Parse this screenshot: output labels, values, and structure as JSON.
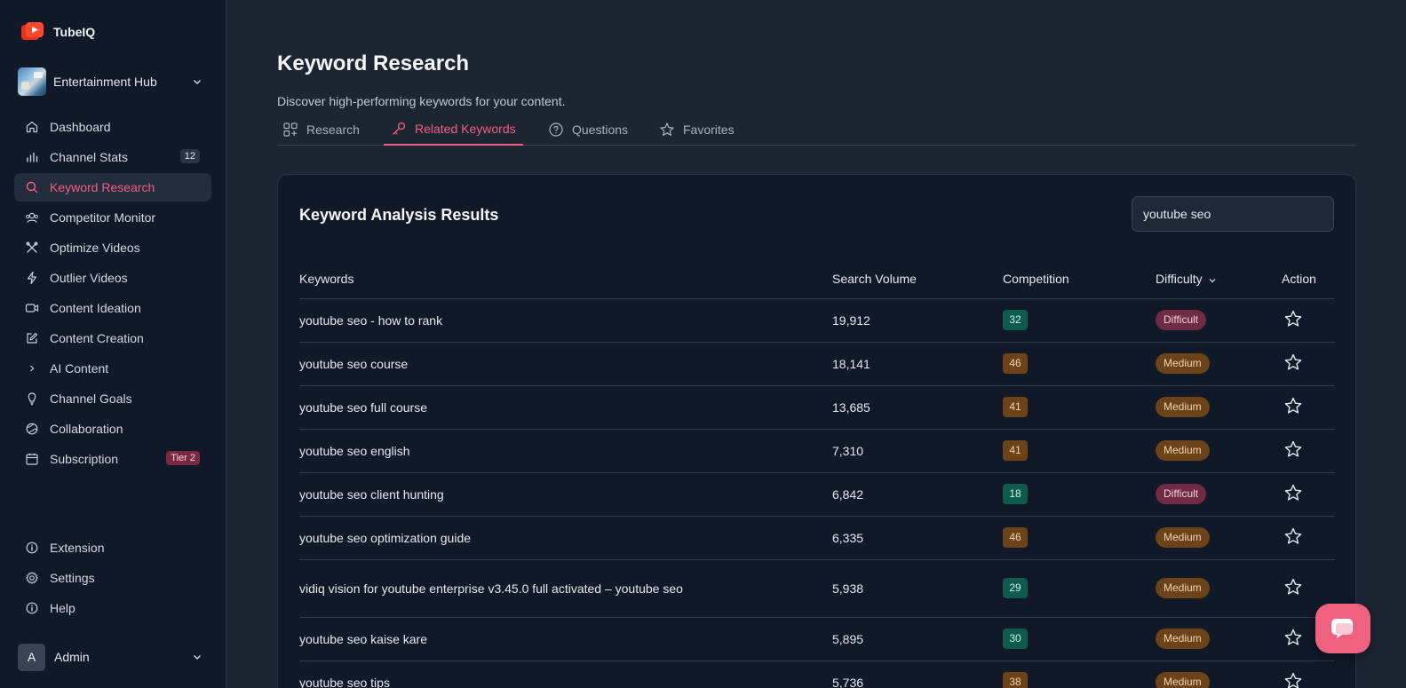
{
  "brand": {
    "name": "TubeIQ"
  },
  "channel": {
    "name": "Entertainment Hub"
  },
  "sidebar": {
    "items": [
      {
        "label": "Dashboard",
        "icon": "home-icon"
      },
      {
        "label": "Channel Stats",
        "icon": "bar-chart-icon",
        "badge": "12"
      },
      {
        "label": "Keyword Research",
        "icon": "search-icon",
        "active": true
      },
      {
        "label": "Competitor Monitor",
        "icon": "users-icon"
      },
      {
        "label": "Optimize Videos",
        "icon": "tools-icon"
      },
      {
        "label": "Outlier Videos",
        "icon": "bolt-icon"
      },
      {
        "label": "Content Ideation",
        "icon": "video-icon"
      },
      {
        "label": "Content Creation",
        "icon": "edit-icon"
      },
      {
        "label": "AI Content",
        "icon": "chevron-right-icon"
      },
      {
        "label": "Channel Goals",
        "icon": "lightbulb-icon"
      },
      {
        "label": "Collaboration",
        "icon": "globe-icon"
      },
      {
        "label": "Subscription",
        "icon": "calendar-icon",
        "badge": "Tier 2"
      }
    ],
    "bottom": [
      {
        "label": "Extension",
        "icon": "info-icon"
      },
      {
        "label": "Settings",
        "icon": "gear-icon"
      },
      {
        "label": "Help",
        "icon": "info-icon"
      }
    ]
  },
  "user": {
    "initial": "A",
    "name": "Admin"
  },
  "page": {
    "title": "Keyword Research",
    "subtitle": "Discover high-performing keywords for your content."
  },
  "tabs": [
    {
      "label": "Research",
      "icon": "grid-icon"
    },
    {
      "label": "Related Keywords",
      "icon": "key-icon",
      "active": true
    },
    {
      "label": "Questions",
      "icon": "question-icon"
    },
    {
      "label": "Favorites",
      "icon": "star-icon"
    }
  ],
  "results": {
    "title": "Keyword Analysis Results",
    "search_value": "youtube seo",
    "columns": [
      "Keywords",
      "Search Volume",
      "Competition",
      "Difficulty",
      "Action"
    ],
    "rows": [
      {
        "keyword": "youtube seo - how to rank",
        "volume": "19,912",
        "competition": "32",
        "comp_level": "green",
        "difficulty": "Difficult"
      },
      {
        "keyword": "youtube seo course",
        "volume": "18,141",
        "competition": "46",
        "comp_level": "orange",
        "difficulty": "Medium"
      },
      {
        "keyword": "youtube seo full course",
        "volume": "13,685",
        "competition": "41",
        "comp_level": "orange",
        "difficulty": "Medium"
      },
      {
        "keyword": "youtube seo english",
        "volume": "7,310",
        "competition": "41",
        "comp_level": "orange",
        "difficulty": "Medium"
      },
      {
        "keyword": "youtube seo client hunting",
        "volume": "6,842",
        "competition": "18",
        "comp_level": "green",
        "difficulty": "Difficult"
      },
      {
        "keyword": "youtube seo optimization guide",
        "volume": "6,335",
        "competition": "46",
        "comp_level": "orange",
        "difficulty": "Medium"
      },
      {
        "keyword": "vidiq vision for youtube enterprise v3.45.0 full activated – youtube seo",
        "volume": "5,938",
        "competition": "29",
        "comp_level": "green",
        "difficulty": "Medium"
      },
      {
        "keyword": "youtube seo kaise kare",
        "volume": "5,895",
        "competition": "30",
        "comp_level": "green",
        "difficulty": "Medium"
      },
      {
        "keyword": "youtube seo tips",
        "volume": "5,736",
        "competition": "38",
        "comp_level": "orange",
        "difficulty": "Medium"
      }
    ]
  },
  "colors": {
    "accent": "#f0607f",
    "sidebar_bg": "#111827",
    "main_bg": "#1d2533"
  }
}
